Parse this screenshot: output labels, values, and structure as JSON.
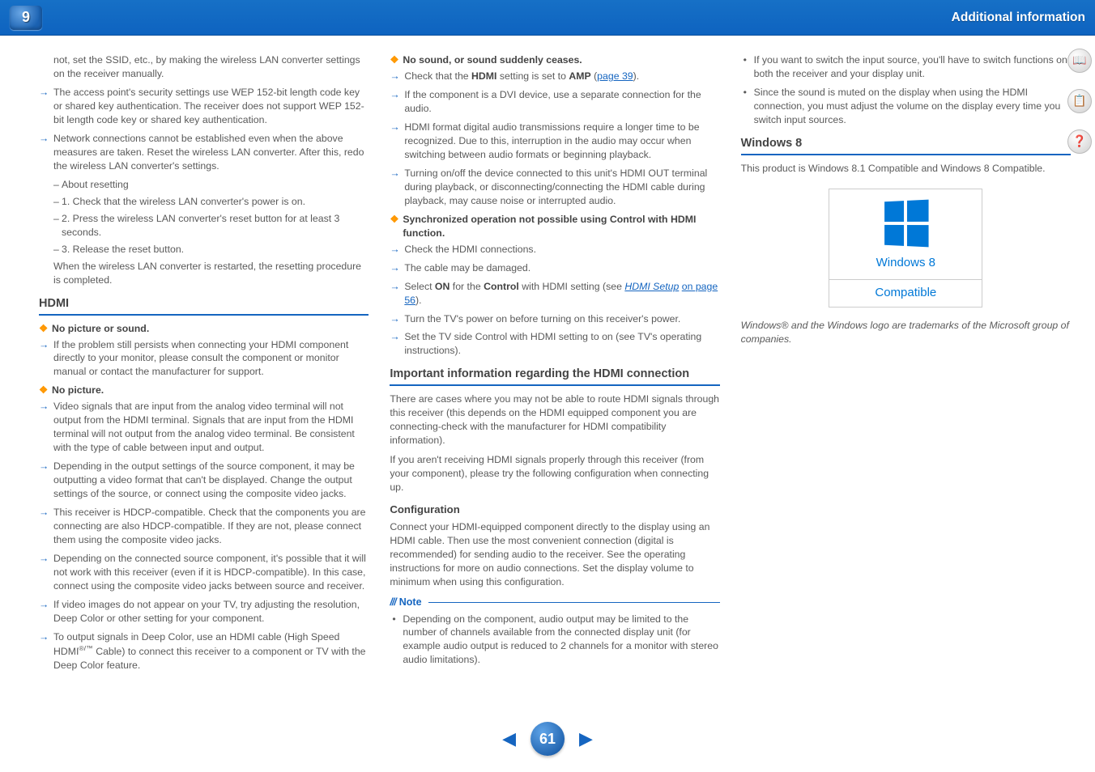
{
  "header": {
    "chapter_number": "9",
    "title": "Additional information"
  },
  "col1": {
    "cont": "not, set the SSID, etc., by making the wireless LAN converter settings on the receiver manually.",
    "arr1": "The access point's security settings use WEP 152-bit length code key or shared key authentication. The receiver does not support WEP 152-bit length code key or shared key authentication.",
    "arr2": "Network connections cannot be established even when the above measures are taken. Reset the wireless LAN converter. After this, redo the wireless LAN converter's settings.",
    "d1": "About resetting",
    "d2": "1. Check that the wireless LAN converter's power is on.",
    "d3": "2. Press the wireless LAN converter's reset button for at least 3 seconds.",
    "d4": "3. Release the reset button.",
    "sub_after": "When the wireless LAN converter is restarted, the resetting procedure is completed.",
    "hdmi_heading": "HDMI",
    "diamond1": "No picture or sound.",
    "arr3": "If the problem still persists when connecting your HDMI component directly to your monitor, please consult the component or monitor manual or contact the manufacturer for support.",
    "diamond2": "No picture.",
    "arr4": "Video signals that are input from the analog video terminal will not output from the HDMI terminal. Signals that are input from the HDMI terminal will not output from the analog video terminal. Be consistent with the type of cable between input and output.",
    "arr5": "Depending in the output settings of the source component, it may be outputting a video format that can't be displayed. Change the output settings of the source, or connect using the composite video jacks.",
    "arr6": "This receiver is HDCP-compatible. Check that the components you are connecting are also HDCP-compatible. If they are not, please connect them using the composite video jacks.",
    "arr7": "Depending on the connected source component, it's possible that it will not work with this receiver (even if it is HDCP-compatible). In this case, connect using the composite video jacks between source and receiver.",
    "arr8": "If video images do not appear on your TV, try adjusting the resolution, Deep Color or other setting for your component.",
    "arr9_pre": "To output signals in Deep Color, use an HDMI cable (High Speed HDMI",
    "arr9_post": " Cable) to connect this receiver to a component or TV with the Deep Color feature."
  },
  "col2": {
    "diamond3": "No sound, or sound suddenly ceases.",
    "arr10_pre": "Check that the ",
    "arr10_hdmi": "HDMI",
    "arr10_mid": " setting is set to ",
    "arr10_amp": "AMP",
    "arr10_post": " (",
    "arr10_link": "page 39",
    "arr10_end": ").",
    "arr11": "If the component is a DVI device, use a separate connection for the audio.",
    "arr12": "HDMI format digital audio transmissions require a longer time to be recognized. Due to this, interruption in the audio may occur when switching between audio formats or beginning playback.",
    "arr13": "Turning on/off the device connected to this unit's HDMI OUT terminal during playback, or disconnecting/connecting the HDMI cable during playback, may cause noise or interrupted audio.",
    "diamond4": "Synchronized operation not possible using Control with HDMI function.",
    "arr14": "Check the HDMI connections.",
    "arr15": "The cable may be damaged.",
    "arr16_pre": "Select ",
    "arr16_on": "ON",
    "arr16_mid": " for the ",
    "arr16_ctrl": "Control",
    "arr16_mid2": " with HDMI setting (see ",
    "arr16_link": "HDMI Setup",
    "arr16_link2": "on page 56",
    "arr16_end": ").",
    "arr17": "Turn the TV's power on before turning on this receiver's power.",
    "arr18": "Set the TV side Control with HDMI setting to on (see TV's operating instructions).",
    "important_heading": "Important information regarding the HDMI connection",
    "imp_p1": "There are cases where you may not be able to route HDMI signals through this receiver (this depends on the HDMI equipped component you are connecting-check with the manufacturer for HDMI compatibility information).",
    "imp_p2": "If you aren't receiving HDMI signals properly through this receiver (from your component), please try the following configuration when connecting up.",
    "config_heading": "Configuration",
    "config_p": "Connect your HDMI-equipped component directly to the display using an HDMI cable. Then use the most convenient connection (digital is recommended) for sending audio to the receiver. See the operating instructions for more on audio connections. Set the display volume to minimum when using this configuration.",
    "note_label": "Note",
    "note_b1": "Depending on the component, audio output may be limited to the number of channels available from the connected display unit (for example audio output is reduced to 2 channels for a monitor with stereo audio limitations)."
  },
  "col3": {
    "b1": "If you want to switch the input source, you'll have to switch functions on both the receiver and your display unit.",
    "b2": "Since the sound is muted on the display when using the HDMI connection, you must adjust the volume on the display every time you switch input sources.",
    "win_heading": "Windows 8",
    "win_p": "This product is Windows 8.1 Compatible and Windows 8 Compatible.",
    "win_badge_top": "Windows 8",
    "win_badge_bottom": "Compatible",
    "tm": "Windows® and the Windows logo are trademarks of the Microsoft group of companies."
  },
  "footer": {
    "page": "61"
  }
}
